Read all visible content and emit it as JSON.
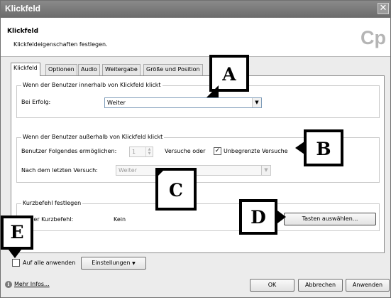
{
  "window": {
    "title": "Klickfeld",
    "close_glyph": "✕"
  },
  "header": {
    "title": "Klickfeld",
    "subtitle": "Klickfeldeigenschaften festlegen.",
    "logo": "Cp"
  },
  "tabs": [
    {
      "label": "Klickfeld",
      "active": true
    },
    {
      "label": "Optionen",
      "active": false
    },
    {
      "label": "Audio",
      "active": false
    },
    {
      "label": "Weitergabe",
      "active": false
    },
    {
      "label": "Größe und Position",
      "active": false
    }
  ],
  "inside_group": {
    "legend": "Wenn der Benutzer innerhalb von Klickfeld klickt",
    "success_label": "Bei Erfolg:",
    "success_value": "Weiter"
  },
  "outside_group": {
    "legend": "Wenn der Benutzer außerhalb von Klickfeld klickt",
    "allow_label": "Benutzer Folgendes ermöglichen:",
    "attempts_value": "1",
    "attempts_suffix": "Versuche oder",
    "unlimited_label": "Unbegrenzte Versuche",
    "unlimited_checked": true,
    "last_attempt_label": "Nach dem letzten Versuch:",
    "last_attempt_value": "Weiter"
  },
  "shortcut_group": {
    "legend": "Kurzbefehl festlegen",
    "current_label": "eller Kurzbefehl:",
    "current_value": "Kein",
    "choose_keys_button": "Tasten auswählen..."
  },
  "footer": {
    "apply_all_label": "Auf alle anwenden",
    "apply_all_checked": false,
    "settings_button": "Einstellungen",
    "more_info_link": "Mehr Infos...",
    "ok_button": "OK",
    "cancel_button": "Abbrechen",
    "apply_button": "Anwenden"
  },
  "callouts": {
    "a": "A",
    "b": "B",
    "c": "C",
    "d": "D",
    "e": "E"
  },
  "icons": {
    "close": "close-icon",
    "dropdown": "chevron-down-icon",
    "info": "info-icon",
    "spinner": "spinner-arrows-icon"
  }
}
